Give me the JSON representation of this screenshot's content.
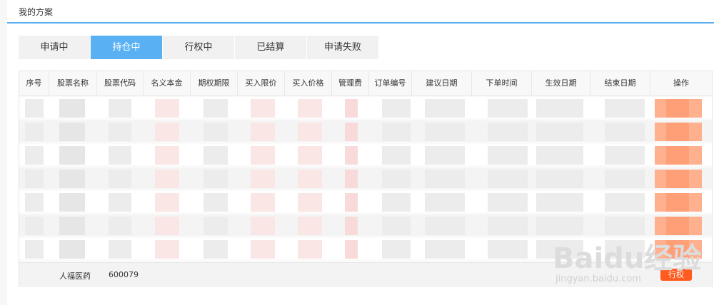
{
  "panel": {
    "title": "我的方案"
  },
  "tabs": [
    {
      "label": "申请中",
      "active": false
    },
    {
      "label": "持仓中",
      "active": true
    },
    {
      "label": "行权中",
      "active": false
    },
    {
      "label": "已结算",
      "active": false
    },
    {
      "label": "申请失败",
      "active": false
    }
  ],
  "table": {
    "headers": [
      "序号",
      "股票名称",
      "股票代码",
      "名义本金",
      "期权期限",
      "买入限价",
      "买入价格",
      "管理费",
      "订单编号",
      "建议日期",
      "下单时间",
      "生效日期",
      "结束日期",
      "操作"
    ],
    "last_row": {
      "stock_name": "人福医药",
      "stock_code": "600079",
      "action_label": "行权"
    }
  },
  "watermark": {
    "logo": "Baidu经验",
    "url": "jingyan.baidu.com"
  },
  "colors": {
    "accent": "#59b1f4",
    "action": "#ff5a1f"
  }
}
